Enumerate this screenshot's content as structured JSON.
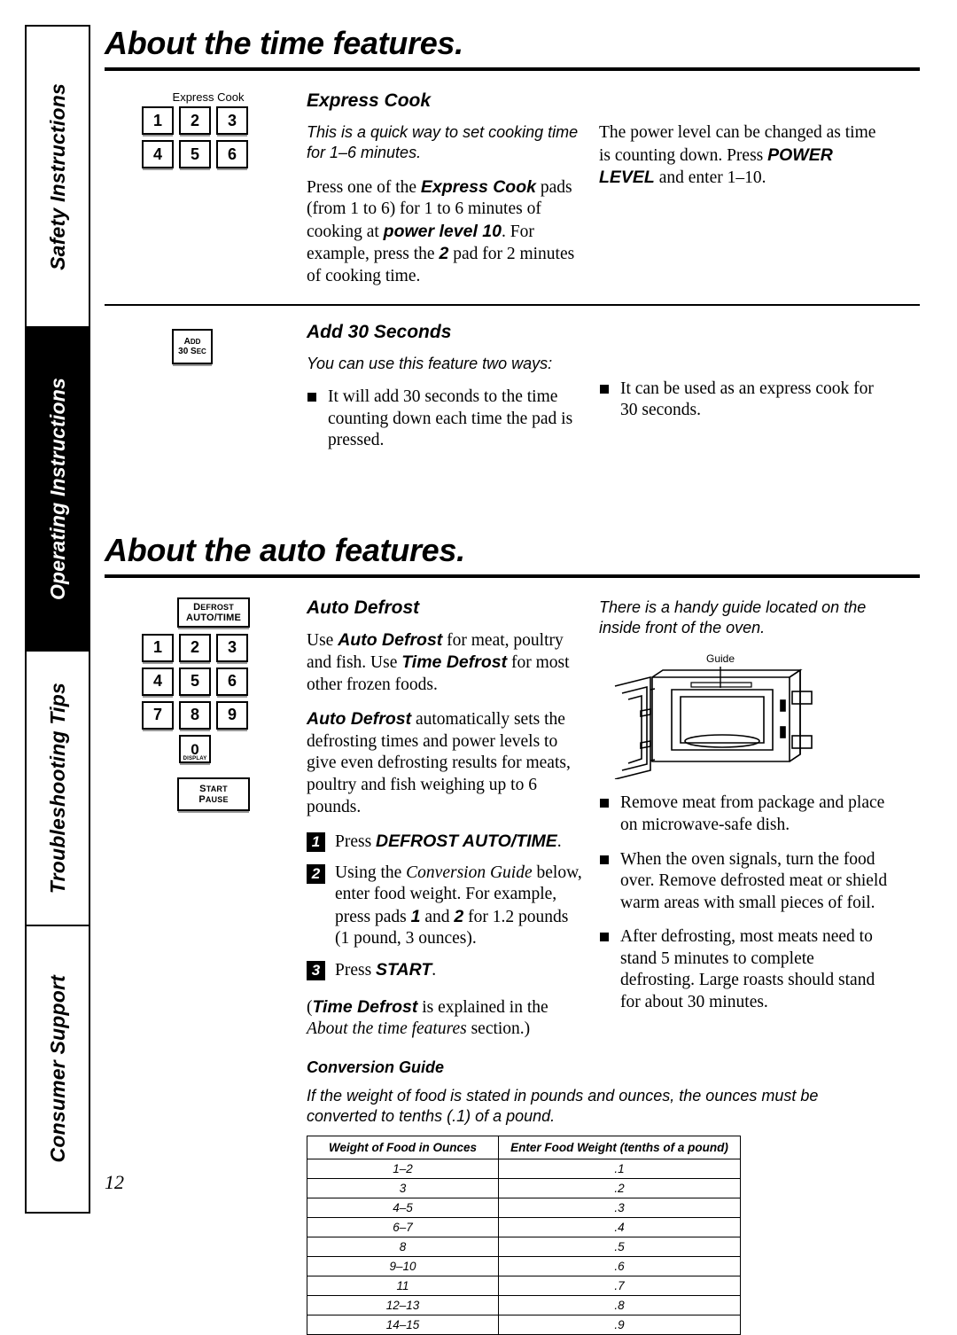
{
  "sidebar": {
    "tabs": [
      {
        "label": "Safety Instructions",
        "active": false
      },
      {
        "label": "Operating Instructions",
        "active": true
      },
      {
        "label": "Troubleshooting Tips",
        "active": false
      },
      {
        "label": "Consumer Support",
        "active": false
      }
    ]
  },
  "page_number": "12",
  "section_time": {
    "title": "About the time features.",
    "express_cook": {
      "heading": "Express Cook",
      "keypad_caption": "Express Cook",
      "keys": [
        "1",
        "2",
        "3",
        "4",
        "5",
        "6"
      ],
      "intro": "This is a quick way to set cooking time for 1–6 minutes.",
      "body_1": "Press one of the ",
      "body_bold_1": "Express Cook",
      "body_2": " pads (from 1 to 6) for 1 to 6 minutes of cooking at ",
      "body_bold_2": "power level 10",
      "body_3": ". For example, press the ",
      "body_bold_3": "2",
      "body_4": " pad for 2 minutes of cooking time.",
      "right_1": "The power level can be changed as time is counting down. Press ",
      "right_bold": "POWER LEVEL",
      "right_2": " and enter 1–10."
    },
    "add_30": {
      "heading": "Add 30 Seconds",
      "key_line1": "A",
      "key_line1_small": "DD",
      "key_line2": "30 S",
      "key_line2_small": "EC",
      "intro": "You can use this feature two ways:",
      "bullets": [
        "It will add 30 seconds to the time counting down each time the pad is pressed.",
        "It can be used as an express cook for 30 seconds."
      ]
    }
  },
  "section_auto": {
    "title": "About the auto features.",
    "auto_defrost": {
      "heading": "Auto Defrost",
      "keypad": {
        "defrost_key_line1": "D",
        "defrost_key_line1_small": "EFROST",
        "defrost_key_line2": "AUTO/TIME",
        "digits": [
          "1",
          "2",
          "3",
          "4",
          "5",
          "6",
          "7",
          "8",
          "9"
        ],
        "zero": "0",
        "zero_sub": "DISPLAY",
        "start_line1": "S",
        "start_line1_small": "TART",
        "start_line2": "P",
        "start_line2_small": "AUSE"
      },
      "para1_a": "Use ",
      "para1_bold1": "Auto Defrost",
      "para1_b": " for meat, poultry and fish. Use ",
      "para1_bold2": "Time Defrost",
      "para1_c": " for most other frozen foods.",
      "para2_bold": "Auto Defrost",
      "para2_rest": " automatically sets the defrosting times and power levels to give even defrosting results for meats, poultry and fish weighing up to 6 pounds.",
      "steps": [
        {
          "num": "1",
          "text_a": "Press ",
          "bold": "DEFROST AUTO/TIME",
          "text_b": "."
        },
        {
          "num": "2",
          "text_a": "Using the ",
          "bold": "Conversion Guide",
          "text_b": " below, enter food weight. For example, press pads ",
          "bold2": "1",
          "text_c": " and ",
          "bold3": "2",
          "text_d": " for 1.2 pounds (1 pound, 3 ounces)."
        },
        {
          "num": "3",
          "text_a": "Press ",
          "bold": "START",
          "text_b": "."
        }
      ],
      "note_a": "(",
      "note_bold1": "Time Defrost",
      "note_b": " is explained in the ",
      "note_ital": "About the time features",
      "note_c": " section.)",
      "right_intro": "There is a handy guide located on the inside front of the oven.",
      "oven_guide_label": "Guide",
      "right_bullets": [
        "Remove meat from package and place on microwave-safe dish.",
        "When the oven signals, turn the food over. Remove defrosted meat or shield warm areas with small pieces of foil.",
        "After defrosting, most meats need to stand 5 minutes to complete defrosting. Large roasts should stand for about 30 minutes."
      ]
    },
    "conversion_guide": {
      "heading": "Conversion Guide",
      "intro": "If the weight of food is stated in pounds and ounces, the ounces must be converted to tenths (.1) of a pound.",
      "headers": [
        "Weight of Food in Ounces",
        "Enter Food Weight (tenths of a pound)"
      ],
      "rows": [
        [
          "1–2",
          ".1"
        ],
        [
          "3",
          ".2"
        ],
        [
          "4–5",
          ".3"
        ],
        [
          "6–7",
          ".4"
        ],
        [
          "8",
          ".5"
        ],
        [
          "9–10",
          ".6"
        ],
        [
          "11",
          ".7"
        ],
        [
          "12–13",
          ".8"
        ],
        [
          "14–15",
          ".9"
        ]
      ]
    }
  }
}
